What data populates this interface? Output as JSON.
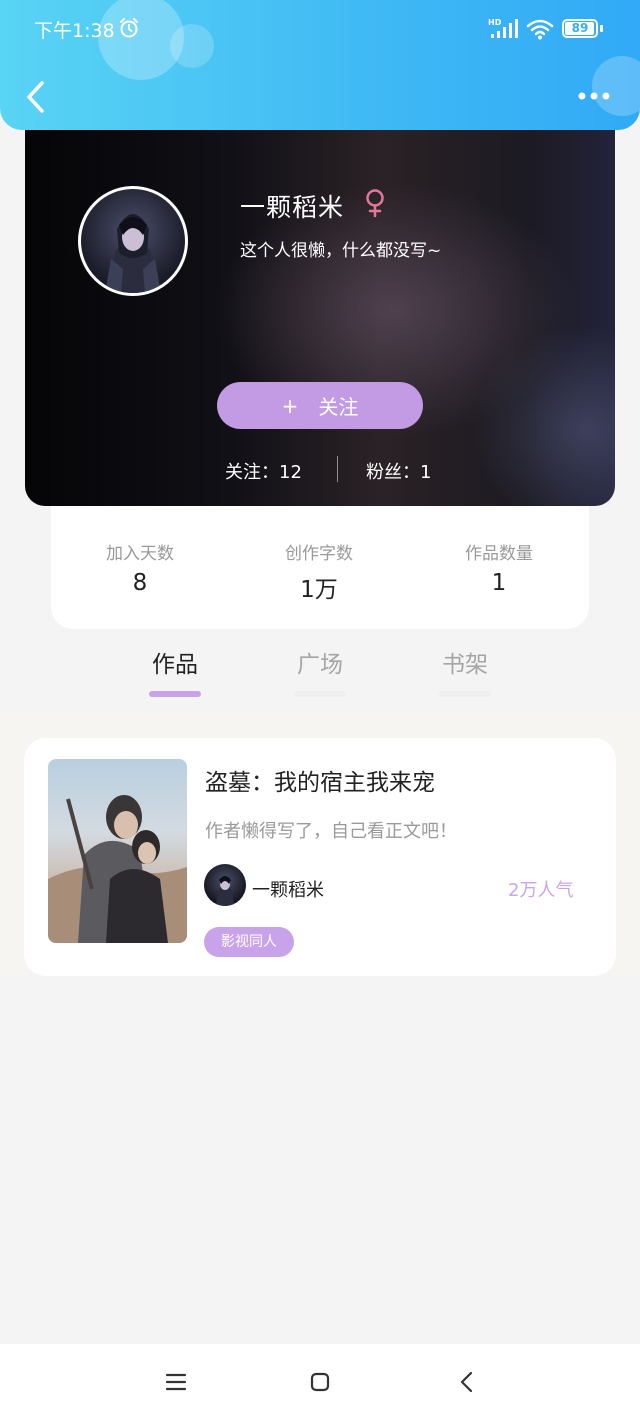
{
  "status_bar": {
    "time": "下午1:38",
    "battery": "89",
    "icons": [
      "alarm-icon",
      "hd-signal-icon",
      "wifi-icon",
      "battery-icon"
    ]
  },
  "nav": {
    "icons": [
      "chevron-left-icon",
      "more-dots-icon"
    ]
  },
  "profile": {
    "nickname": "一颗稻米",
    "bio": "这个人很懒，什么都没写~",
    "gender_symbol": "♀",
    "follow_button": "关注",
    "follow_plus": "+",
    "following": "关注：12",
    "followers": "粉丝：1"
  },
  "stats": [
    {
      "label": "加入天数",
      "value": "8"
    },
    {
      "label": "创作字数",
      "value": "1万"
    },
    {
      "label": "作品数量",
      "value": "1"
    }
  ],
  "tabs": [
    {
      "label": "作品",
      "active": true
    },
    {
      "label": "广场",
      "active": false
    },
    {
      "label": "书架",
      "active": false
    }
  ],
  "works": [
    {
      "title": "盗墓：我的宿主我来宠",
      "description": "作者懒得写了，自己看正文吧！",
      "author": "一颗稻米",
      "popularity": "2万人气",
      "tag": "影视同人"
    }
  ],
  "colors": {
    "header_gradient_start": "#59d4f4",
    "header_gradient_end": "#31aaf7",
    "accent_purple": "#c39ae4",
    "gender_pink": "#e07a9a",
    "popularity": "#cba4ea"
  },
  "bottom_nav": {
    "icons": [
      "menu-icon",
      "home-square-icon",
      "back-chevron-icon"
    ]
  }
}
